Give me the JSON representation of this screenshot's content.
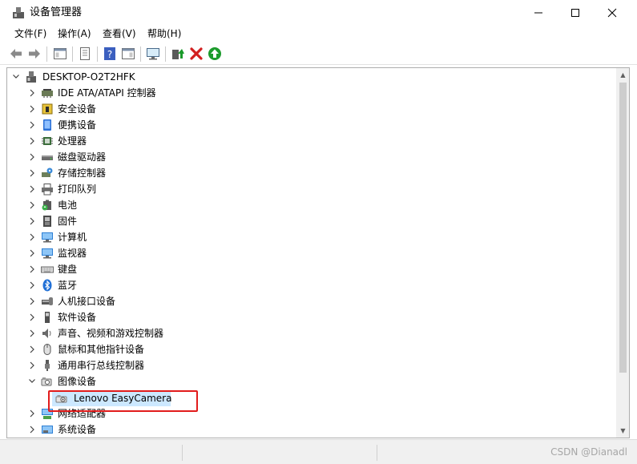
{
  "window": {
    "title": "设备管理器",
    "controls": {
      "minimize": "—",
      "maximize": "☐",
      "close": "✕"
    }
  },
  "menu": [
    {
      "label": "文件(F)"
    },
    {
      "label": "操作(A)"
    },
    {
      "label": "查看(V)"
    },
    {
      "label": "帮助(H)"
    }
  ],
  "toolbar": [
    "back-arrow-icon",
    "forward-arrow-icon",
    "properties-panel-icon",
    "document-icon",
    "help-icon",
    "action-pane-icon",
    "monitor-scan-icon",
    "update-driver-icon",
    "uninstall-x-icon",
    "enable-device-icon"
  ],
  "tree": {
    "root": "DESKTOP-O2T2HFK",
    "categories": [
      {
        "label": "IDE ATA/ATAPI 控制器",
        "icon": "ide-controller-icon"
      },
      {
        "label": "安全设备",
        "icon": "security-key-icon"
      },
      {
        "label": "便携设备",
        "icon": "portable-device-icon"
      },
      {
        "label": "处理器",
        "icon": "processor-icon"
      },
      {
        "label": "磁盘驱动器",
        "icon": "disk-drive-icon"
      },
      {
        "label": "存储控制器",
        "icon": "storage-controller-icon"
      },
      {
        "label": "打印队列",
        "icon": "printer-icon"
      },
      {
        "label": "电池",
        "icon": "battery-icon"
      },
      {
        "label": "固件",
        "icon": "firmware-icon"
      },
      {
        "label": "计算机",
        "icon": "computer-icon"
      },
      {
        "label": "监视器",
        "icon": "monitor-icon"
      },
      {
        "label": "键盘",
        "icon": "keyboard-icon"
      },
      {
        "label": "蓝牙",
        "icon": "bluetooth-icon"
      },
      {
        "label": "人机接口设备",
        "icon": "hid-icon"
      },
      {
        "label": "软件设备",
        "icon": "software-device-icon"
      },
      {
        "label": "声音、视频和游戏控制器",
        "icon": "speaker-icon"
      },
      {
        "label": "鼠标和其他指针设备",
        "icon": "mouse-icon"
      },
      {
        "label": "通用串行总线控制器",
        "icon": "usb-icon"
      },
      {
        "label": "图像设备",
        "icon": "camera-icon",
        "expanded": true
      },
      {
        "label": "网络适配器",
        "icon": "network-adapter-icon"
      },
      {
        "label": "系统设备",
        "icon": "system-device-icon"
      }
    ],
    "child_of_image_devices": {
      "label": "Lenovo EasyCamera",
      "icon": "webcam-icon",
      "selected": true
    }
  },
  "status": {
    "watermark": "CSDN @Dianadl"
  },
  "colors": {
    "selection": "#cce8ff",
    "annotation": "#e21c1c"
  }
}
